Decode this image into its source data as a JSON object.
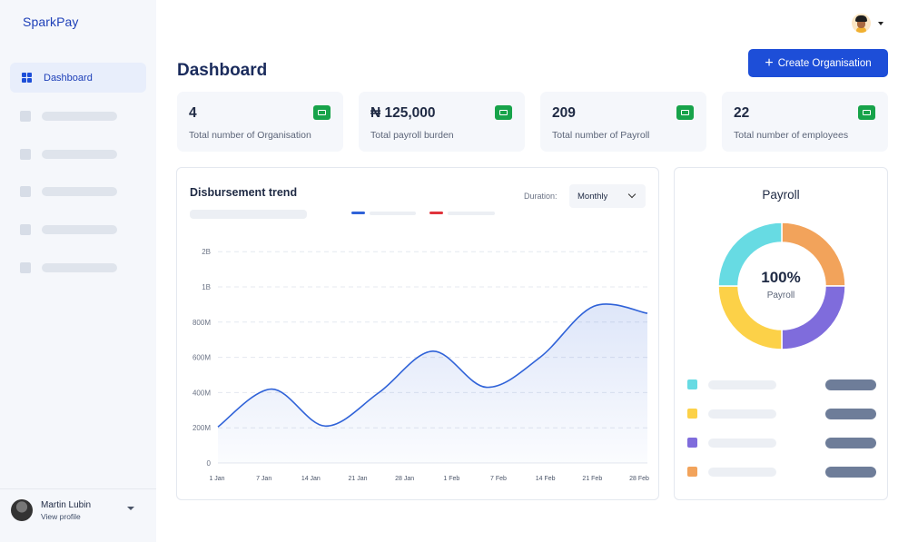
{
  "app": {
    "brand": "SparkPay"
  },
  "sidebar": {
    "items": [
      {
        "label": "Dashboard",
        "icon": "dashboard-grid-icon",
        "active": true
      }
    ]
  },
  "profile": {
    "name": "Martin Lubin",
    "subtitle": "View profile"
  },
  "header": {
    "title": "Dashboard",
    "create_label": "Create Organisation"
  },
  "stats": [
    {
      "value": "4",
      "label": "Total number of Organisation",
      "icon": "briefcase-icon"
    },
    {
      "value": "₦ 125,000",
      "label": "Total payroll burden",
      "icon": "wallet-icon"
    },
    {
      "value": "209",
      "label": "Total number of Payroll",
      "icon": "document-icon"
    },
    {
      "value": "22",
      "label": "Total number of employees",
      "icon": "user-icon"
    }
  ],
  "trend": {
    "title": "Disbursement trend",
    "duration_label": "Duration:",
    "duration_value": "Monthly"
  },
  "payroll": {
    "title": "Payroll",
    "center_value": "100%",
    "center_label": "Payroll"
  },
  "colors": {
    "primary": "#1d4ed8",
    "icon_green": "#17a34a",
    "line": "#2f62d8",
    "legend_red": "#e0343c",
    "donut": [
      "#f2a35b",
      "#7f6cdc",
      "#fcd148",
      "#67dbe3"
    ]
  },
  "chart_data": [
    {
      "type": "area",
      "title": "Disbursement trend",
      "categories": [
        "1 Jan",
        "7 Jan",
        "14 Jan",
        "21 Jan",
        "28 Jan",
        "1 Feb",
        "7 Feb",
        "14 Feb",
        "21 Feb",
        "28 Feb"
      ],
      "y_ticks": [
        "0",
        "200M",
        "400M",
        "600M",
        "800M",
        "1B",
        "2B"
      ],
      "series": [
        {
          "values": [
            205000000,
            420000000,
            210000000,
            400000000,
            635000000,
            430000000,
            600000000,
            890000000,
            850000000
          ]
        }
      ],
      "grid": true
    },
    {
      "type": "pie",
      "title": "Payroll",
      "values": [
        25,
        25,
        25,
        25
      ]
    }
  ]
}
